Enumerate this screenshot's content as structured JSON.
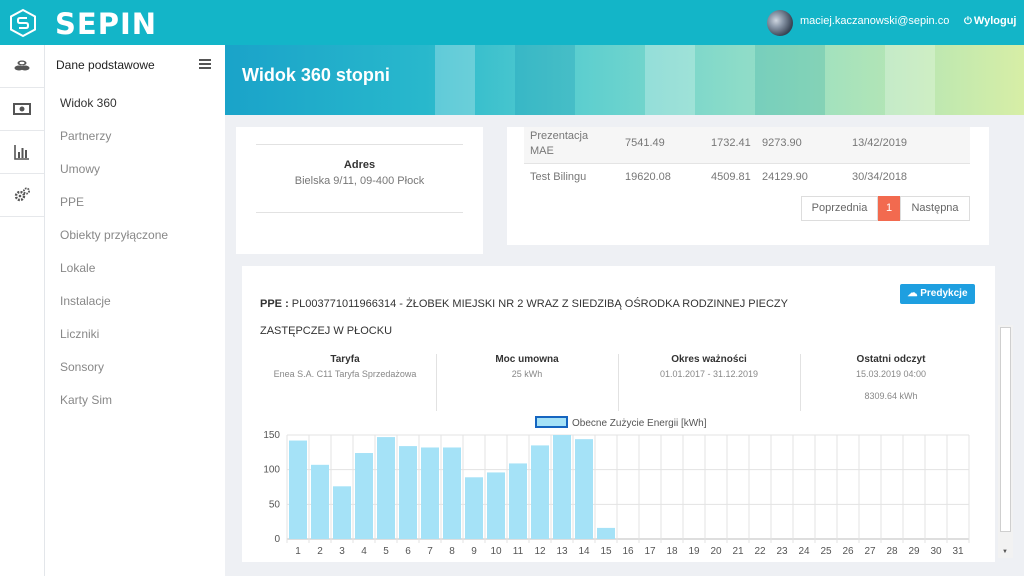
{
  "header": {
    "logo_text": "SEPIN",
    "user_email": "maciej.kaczanowski@sepin.co",
    "logout_label": "Wyloguj"
  },
  "rail": {
    "icons": [
      "coins-icon",
      "money-icon",
      "bar-chart-icon",
      "gears-icon"
    ]
  },
  "sidebar": {
    "title": "Dane podstawowe",
    "items": [
      {
        "label": "Widok 360",
        "active": true
      },
      {
        "label": "Partnerzy"
      },
      {
        "label": "Umowy"
      },
      {
        "label": "PPE"
      },
      {
        "label": "Obiekty przyłączone"
      },
      {
        "label": "Lokale"
      },
      {
        "label": "Instalacje"
      },
      {
        "label": "Liczniki"
      },
      {
        "label": "Sonsory"
      },
      {
        "label": "Karty Sim"
      }
    ]
  },
  "page": {
    "title": "Widok 360 stopni"
  },
  "address": {
    "label": "Adres",
    "value": "Bielska 9/11, 09-400 Płock"
  },
  "invoices": {
    "rows": [
      {
        "name_line1": "Prezentacja",
        "name_line2": "MAE",
        "v1": "7541.49",
        "v2": "1732.41",
        "v3": "9273.90",
        "date": "13/42/2019"
      },
      {
        "name_line1": "Test Bilingu",
        "name_line2": "",
        "v1": "19620.08",
        "v2": "4509.81",
        "v3": "24129.90",
        "date": "30/34/2018"
      }
    ],
    "pager": {
      "prev": "Poprzednia",
      "current": "1",
      "next": "Następna"
    }
  },
  "ppe": {
    "label": "PPE :",
    "text_line1": "PL003771011966314 - ŻŁOBEK MIEJSKI NR 2 WRAZ Z SIEDZIBĄ OŚRODKA RODZINNEJ PIECZY",
    "text_line2": "ZASTĘPCZEJ W PŁOCKU",
    "predict_button": "Predykcje",
    "stats": [
      {
        "label": "Taryfa",
        "value": "Enea S.A. C11 Taryfa Sprzedażowa",
        "value2": ""
      },
      {
        "label": "Moc umowna",
        "value": "25 kWh",
        "value2": ""
      },
      {
        "label": "Okres ważności",
        "value": "01.01.2017 - 31.12.2019",
        "value2": ""
      },
      {
        "label": "Ostatni odczyt",
        "value": "15.03.2019 04:00",
        "value2": "8309.64 kWh"
      }
    ]
  },
  "chart_data": {
    "type": "bar",
    "title": "",
    "xlabel": "",
    "ylabel": "",
    "legend_position": "top-center",
    "grid": true,
    "categories": [
      "1",
      "2",
      "3",
      "4",
      "5",
      "6",
      "7",
      "8",
      "9",
      "10",
      "11",
      "12",
      "13",
      "14",
      "15",
      "16",
      "17",
      "18",
      "19",
      "20",
      "21",
      "22",
      "23",
      "24",
      "25",
      "26",
      "27",
      "28",
      "29",
      "30",
      "31"
    ],
    "series": [
      {
        "name": "Obecne Zużycie Energii [kWh]",
        "color": "#a5e2f7",
        "border_color": "#1565c0",
        "values": [
          142,
          107,
          76,
          124,
          147,
          134,
          132,
          132,
          89,
          96,
          109,
          135,
          150,
          144,
          16,
          0,
          0,
          0,
          0,
          0,
          0,
          0,
          0,
          0,
          0,
          0,
          0,
          0,
          0,
          0,
          0
        ]
      }
    ],
    "ylim": [
      0,
      150
    ],
    "yticks": [
      "0",
      "50",
      "100",
      "150"
    ]
  }
}
